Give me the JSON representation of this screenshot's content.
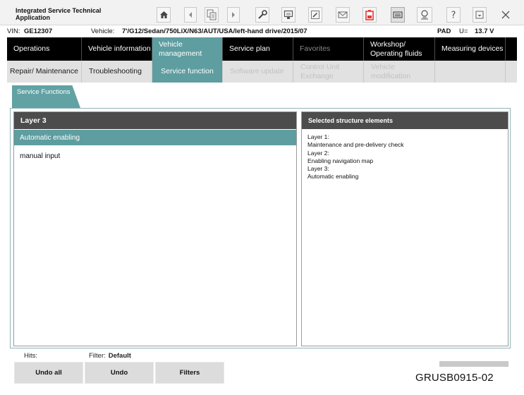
{
  "app": {
    "title": "Integrated Service Technical Application"
  },
  "toolbar": {
    "icons": [
      "home-icon",
      "arrow-left-icon",
      "document-transfer-icon",
      "arrow-right-icon",
      "wrench-icon",
      "stamp-icon",
      "edit-icon",
      "mail-icon",
      "battery-warning-icon",
      "keyboard-icon",
      "vehicle-scan-icon",
      "help-icon",
      "minimize-icon",
      "close-icon"
    ],
    "battery_color": "#e53935"
  },
  "info": {
    "vin_label": "VIN:",
    "vin": "GE12307",
    "vehicle_label": "Vehicle:",
    "vehicle": "7'/G12/Sedan/750LiX/N63/AUT/USA/left-hand drive/2015/07",
    "connection": "PAD",
    "voltage_label": "U=",
    "voltage": "13.7 V"
  },
  "main_nav": {
    "tabs": [
      {
        "label": "Operations"
      },
      {
        "label": "Vehicle information"
      },
      {
        "label": "Vehicle management"
      },
      {
        "label": "Service plan"
      },
      {
        "label": "Favorites"
      },
      {
        "label": "Workshop/ Operating fluids"
      },
      {
        "label": "Measuring devices"
      }
    ],
    "active": "Vehicle management"
  },
  "sub_nav": {
    "tabs": [
      {
        "label": "Repair/ Maintenance"
      },
      {
        "label": "Troubleshooting"
      },
      {
        "label": "Service function"
      },
      {
        "label": "Software update"
      },
      {
        "label": "Control Unit Exchange"
      },
      {
        "label": "Vehicle modification"
      }
    ],
    "active": "Service function"
  },
  "context_tab": {
    "label": "Service Functions"
  },
  "left_panel": {
    "header": "Layer 3",
    "items": [
      {
        "label": "Automatic enabling",
        "selected": true
      },
      {
        "label": "manual input",
        "selected": false
      }
    ]
  },
  "right_panel": {
    "header": "Selected structure elements",
    "lines": [
      "Layer 1:",
      "Maintenance and pre-delivery check",
      "Layer 2:",
      "Enabling navigation map",
      "Layer 3:",
      "Automatic enabling"
    ]
  },
  "footer": {
    "hits_label": "Hits:",
    "filter_label": "Filter:",
    "filter_value": "Default",
    "buttons": [
      {
        "label": "Undo all"
      },
      {
        "label": "Undo"
      },
      {
        "label": "Filters"
      }
    ]
  },
  "figure_code": "GRUSB0915-02",
  "colors": {
    "accent": "#5e9da0",
    "nav_bg": "#000000",
    "subnav_bg": "#e1e1e1",
    "panel_header": "#4c4c4c"
  }
}
